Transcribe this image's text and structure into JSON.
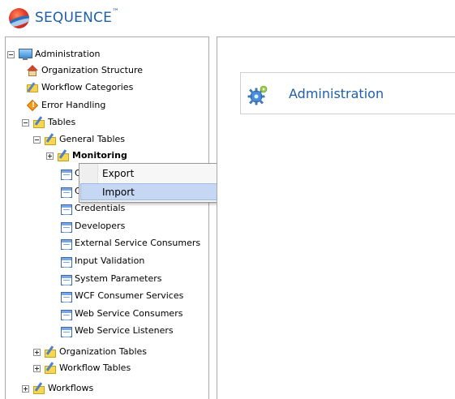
{
  "header": {
    "app_name": "SEQUENCE",
    "trademark": "™"
  },
  "tree": {
    "root": "Administration",
    "org_structure": "Organization Structure",
    "workflow_categories": "Workflow Categories",
    "error_handling": "Error Handling",
    "tables": "Tables",
    "general_tables": "General Tables",
    "monitoring": "Monitoring",
    "partial_1": "C",
    "partial_2": "C",
    "credentials": "Credentials",
    "developers": "Developers",
    "external_service_consumers": "External Service Consumers",
    "input_validation": "Input Validation",
    "system_parameters": "System Parameters",
    "wcf_consumer_services": "WCF Consumer Services",
    "web_service_consumers": "Web Service Consumers",
    "web_service_listeners": "Web Service Listeners",
    "organization_tables": "Organization Tables",
    "workflow_tables": "Workflow Tables",
    "workflows": "Workflows"
  },
  "context_menu": {
    "export": "Export",
    "import": "Import"
  },
  "main": {
    "title": "Administration"
  },
  "colors": {
    "brand_blue": "#1f5fa8",
    "menu_highlight": "#c5d7f2"
  }
}
